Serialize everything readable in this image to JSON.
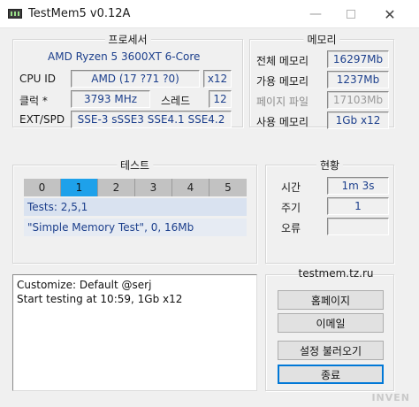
{
  "window": {
    "title": "TestMem5 v0.12A"
  },
  "cpu": {
    "group_title": "프로세서",
    "name": "AMD Ryzen 5 3600XT 6-Core",
    "cpu_id_label": "CPU ID",
    "cpu_id_value": "AMD  (17 ?71 ?0)",
    "threads_count": "x12",
    "clock_label": "클럭 *",
    "clock_value": "3793 MHz",
    "threads_label": "스레드",
    "threads_value": "12",
    "ext_label": "EXT/SPD",
    "ext_value": "SSE-3 sSSE3 SSE4.1 SSE4.2"
  },
  "memory": {
    "group_title": "메모리",
    "total_label": "전체 메모리",
    "total_value": "16297Mb",
    "avail_label": "가용 메모리",
    "avail_value": "1237Mb",
    "page_label": "페이지 파일",
    "page_value": "17103Mb",
    "used_label": "사용 메모리",
    "used_value": "1Gb x12"
  },
  "tests": {
    "group_title": "테스트",
    "cells": [
      "0",
      "1",
      "2",
      "3",
      "4",
      "5"
    ],
    "active_index": 1,
    "tests_line": "Tests: 2,5,1",
    "current_test": "\"Simple Memory Test\", 0, 16Mb"
  },
  "status": {
    "group_title": "현황",
    "time_label": "시간",
    "time_value": "1m 3s",
    "cycle_label": "주기",
    "cycle_value": "1",
    "errors_label": "오류",
    "errors_value": ""
  },
  "log": {
    "lines": [
      "Customize: Default @serj",
      "Start testing at 10:59, 1Gb x12"
    ]
  },
  "side": {
    "site": "testmem.tz.ru",
    "homepage_button": "홈페이지",
    "email_button": "이메일",
    "load_settings_button": "설정 불러오기",
    "exit_button": "종료"
  },
  "watermark": "INVEN",
  "colors": {
    "value_text": "#1c3f8c",
    "active_test": "#1ea1ea",
    "inactive_test": "#c2c2c2",
    "line_bg": "#d9e2f0"
  }
}
